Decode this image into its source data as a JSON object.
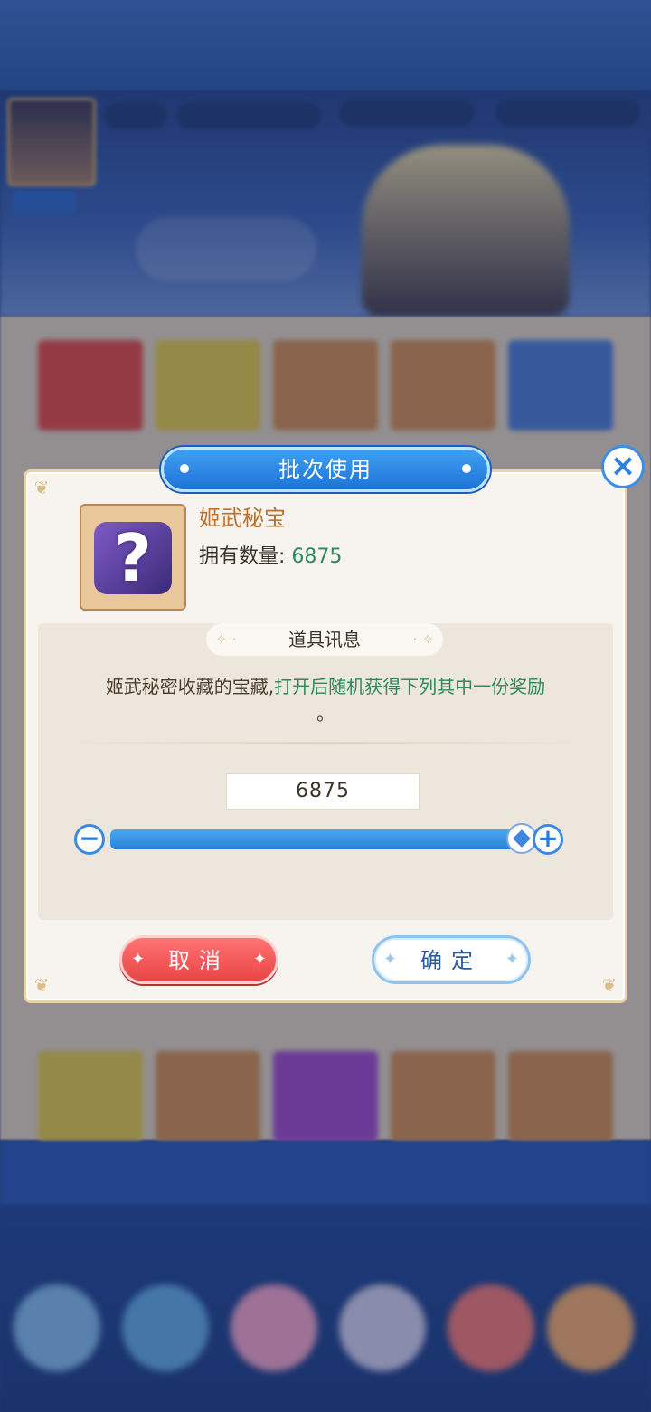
{
  "dialog": {
    "title": "批次使用",
    "close_icon": "close-icon",
    "item": {
      "name": "姬武秘宝",
      "count_label": "拥有数量:",
      "count_value": "6875",
      "icon": "mystery-chest-icon"
    },
    "info": {
      "header": "道具讯息",
      "desc_part1": "姬武秘密收藏的宝藏,",
      "desc_part2": "打开后随机获得下列其中一份奖励",
      "desc_part3": "。"
    },
    "quantity": {
      "value": "6875",
      "max": 6875,
      "fraction": 1.0
    },
    "buttons": {
      "cancel": "取消",
      "confirm": "确定"
    }
  },
  "colors": {
    "accent_blue": "#2b82db",
    "cancel_red": "#e84545",
    "count_green": "#2e8a5a",
    "name_orange": "#c0702a"
  }
}
